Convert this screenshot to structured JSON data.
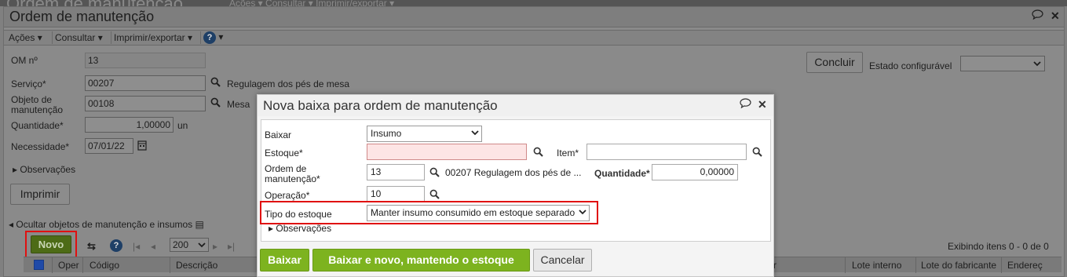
{
  "bg": {
    "top_title": "Ordem de manutenção",
    "top_menu": "Ações ▾  Consultar ▾  Imprimir/exportar ▾",
    "window_title": "Ordem de manutenção",
    "menu": {
      "acoes": "Ações",
      "consultar": "Consultar",
      "imprimir": "Imprimir/exportar"
    },
    "form": {
      "om_label": "OM nº",
      "om_value": "13",
      "servico_label": "Serviço*",
      "servico_value": "00207",
      "servico_desc": "Regulagem dos pés de mesa",
      "objeto_label": "Objeto de\nmanutenção",
      "objeto_value": "00108",
      "objeto_desc": "Mesa",
      "quantidade_label": "Quantidade*",
      "quantidade_value": "1,00000",
      "quantidade_unit": "un",
      "necessidade_label": "Necessidade*",
      "necessidade_value": "07/01/22",
      "observacoes": "Observações",
      "imprimir_btn": "Imprimir",
      "concluir_btn": "Concluir",
      "estado_label": "Estado configurável"
    },
    "section_title": "Ocultar objetos de manutenção e insumos",
    "novo_btn": "Novo",
    "page_size": "200",
    "exibindo": "Exibindo itens 0 - 0 de 0",
    "grid_cols": {
      "oper": "Oper",
      "codigo": "Código",
      "descricao": "Descrição",
      "r": "r",
      "lote_interno": "Lote interno",
      "lote_fab": "Lote do fabricante",
      "endereco": "Endereç"
    }
  },
  "modal": {
    "title": "Nova baixa para ordem de manutenção",
    "baixar_label": "Baixar",
    "baixar_value": "Insumo",
    "estoque_label": "Estoque*",
    "estoque_value": "",
    "item_label": "Item*",
    "item_value": "",
    "ordem_label": "Ordem de\nmanutenção*",
    "ordem_value": "13",
    "ordem_desc": "00207 Regulagem dos pés de ...",
    "quantidade_label": "Quantidade*",
    "quantidade_value": "0,00000",
    "operacao_label": "Operação*",
    "operacao_value": "10",
    "tipo_label": "Tipo do estoque",
    "tipo_value": "Manter insumo consumido em estoque separado",
    "observacoes": "Observações",
    "btn_baixar": "Baixar",
    "btn_baixar_novo": "Baixar e novo, mantendo o estoque",
    "btn_cancelar": "Cancelar"
  },
  "colors": {
    "accent_green": "#7db31f",
    "highlight_red": "#e01010",
    "required_bg": "#fde5e5"
  }
}
